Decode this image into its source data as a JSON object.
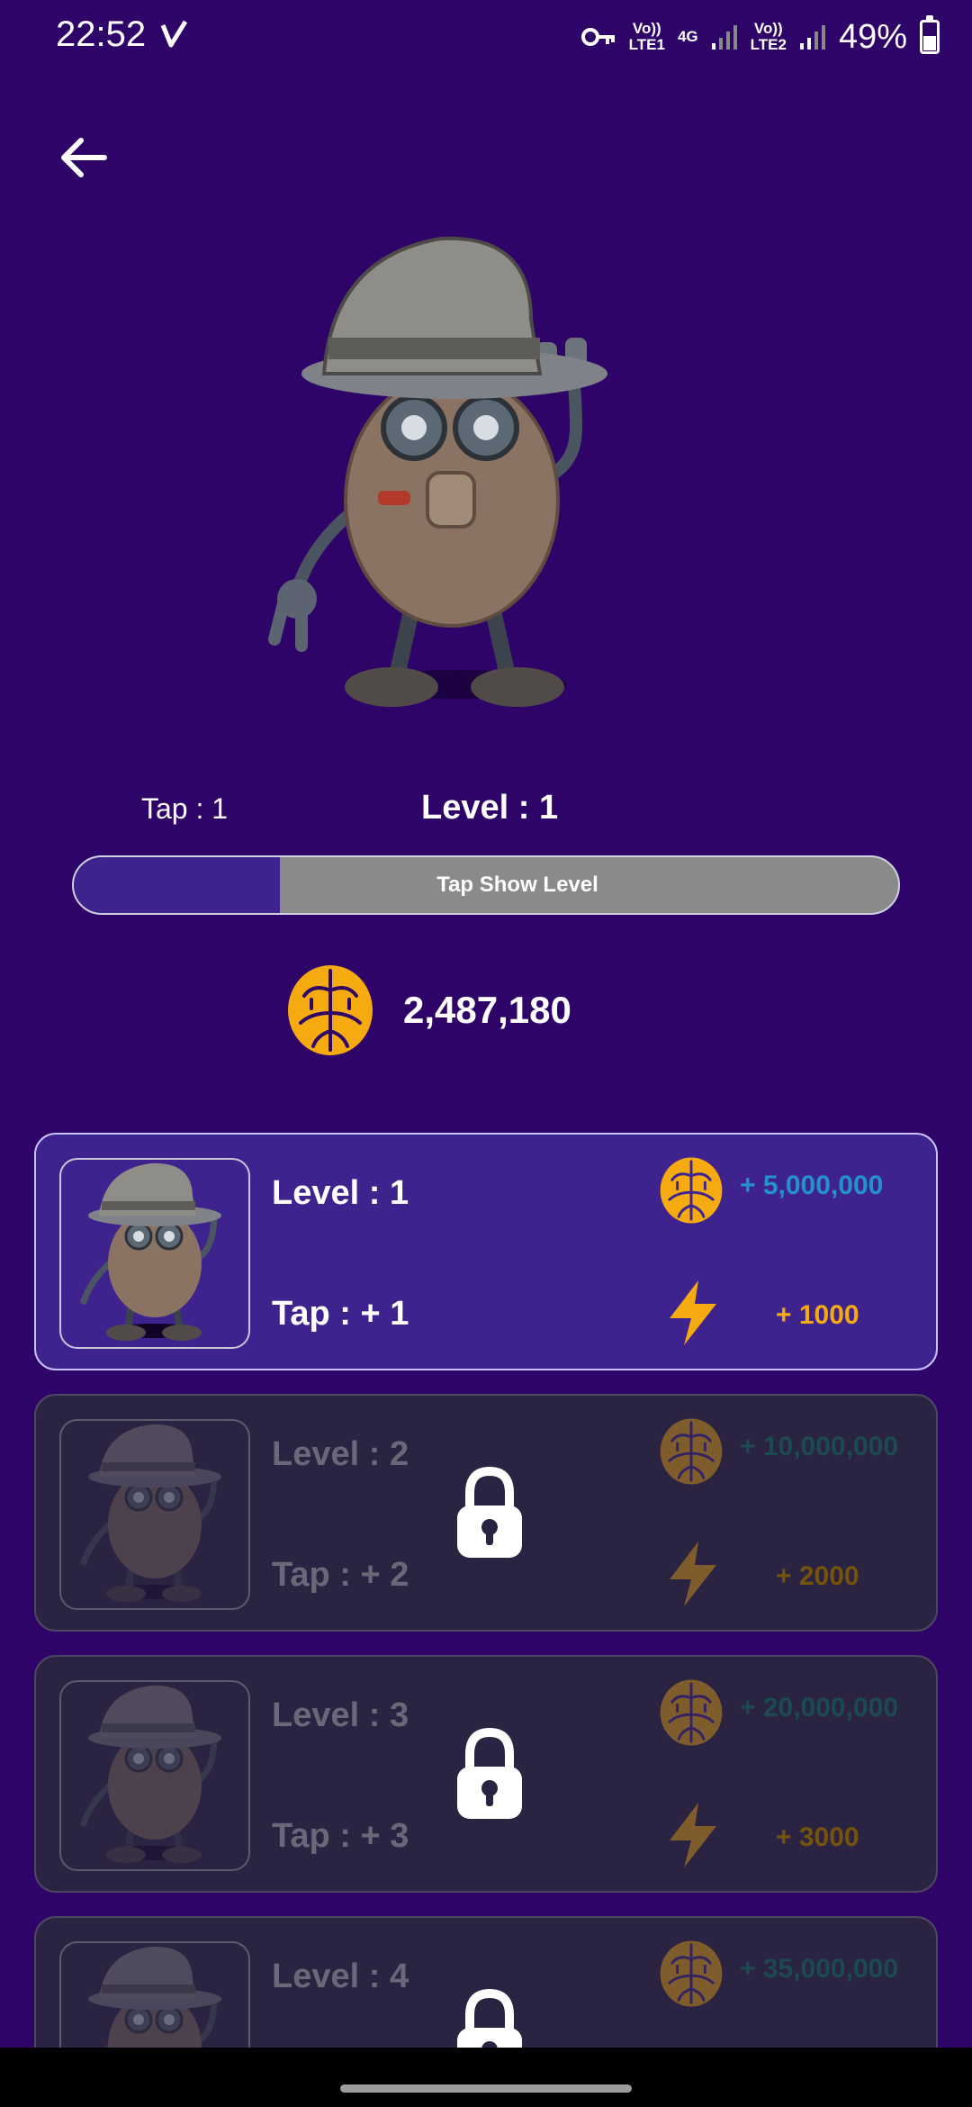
{
  "status_bar": {
    "time": "22:52",
    "sim1_label": "Vo))\nLTE1",
    "net_label": "4G",
    "sim2_label": "Vo))\nLTE2",
    "battery": "49%",
    "battery_level": 0.49
  },
  "header": {
    "back_icon": "arrow-left-icon"
  },
  "hero": {
    "image": "robot-detective-character"
  },
  "stats": {
    "tap_text": "Tap : 1",
    "level_text": "Level : 1"
  },
  "progress": {
    "label": "Tap Show Level",
    "fraction": 0.25
  },
  "balance": {
    "icon": "brain-coin-icon",
    "value": "2,487,180"
  },
  "levels": [
    {
      "level": "Level : 1",
      "tap": "Tap : + 1",
      "cost": "+ 5,000,000",
      "bonus": "+ 1000",
      "locked": false
    },
    {
      "level": "Level : 2",
      "tap": "Tap : + 2",
      "cost": "+ 10,000,000",
      "bonus": "+ 2000",
      "locked": true
    },
    {
      "level": "Level : 3",
      "tap": "Tap : + 3",
      "cost": "+ 20,000,000",
      "bonus": "+ 3000",
      "locked": true
    },
    {
      "level": "Level : 4",
      "tap": "",
      "cost": "+ 35,000,000",
      "bonus": "",
      "locked": true
    }
  ],
  "colors": {
    "background": "#2f0468",
    "card_active": "#3e238f",
    "card_locked": "#2a2342",
    "coin": "#f5ab10",
    "cost_text": "#2491c9"
  }
}
